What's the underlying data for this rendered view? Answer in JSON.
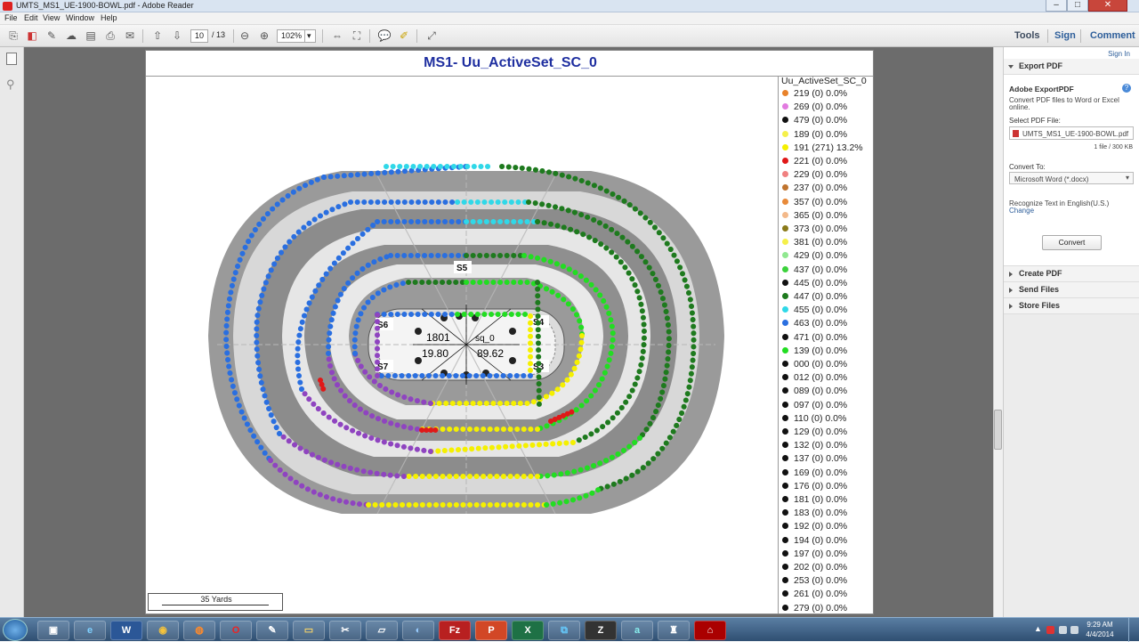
{
  "window": {
    "title": "UMTS_MS1_UE-1900-BOWL.pdf - Adobe Reader",
    "min": "–",
    "max": "□",
    "close": "✕"
  },
  "menu": [
    "File",
    "Edit",
    "View",
    "Window",
    "Help"
  ],
  "toolbar": {
    "page_current": "10",
    "page_total": "/ 13",
    "zoom": "102%",
    "tools": "Tools",
    "sign": "Sign",
    "comment": "Comment"
  },
  "document": {
    "title": "MS1- Uu_ActiveSet_SC_0",
    "scale_label": "35 Yards",
    "map_labels": {
      "s1": "S5",
      "s2": "S4",
      "s3": "S6",
      "s4": "S7",
      "s5": "S3",
      "c1": "1801",
      "c2": "19.80",
      "c3": "sq_0",
      "c4": "89.62"
    }
  },
  "legend": {
    "title": "Uu_ActiveSet_SC_0",
    "items": [
      {
        "label": "219 (0) 0.0%",
        "color": "#e8822a"
      },
      {
        "label": "269 (0) 0.0%",
        "color": "#e27be0"
      },
      {
        "label": "479 (0) 0.0%",
        "color": "#111111"
      },
      {
        "label": "189 (0) 0.0%",
        "color": "#f5f04a"
      },
      {
        "label": "191 (271) 13.2%",
        "color": "#f5f000"
      },
      {
        "label": "221 (0) 0.0%",
        "color": "#e01818"
      },
      {
        "label": "229 (0) 0.0%",
        "color": "#f08080"
      },
      {
        "label": "237 (0) 0.0%",
        "color": "#c0742e"
      },
      {
        "label": "357 (0) 0.0%",
        "color": "#e88a3a"
      },
      {
        "label": "365 (0) 0.0%",
        "color": "#f3b98a"
      },
      {
        "label": "373 (0) 0.0%",
        "color": "#8a7a1a"
      },
      {
        "label": "381 (0) 0.0%",
        "color": "#f5f04a"
      },
      {
        "label": "429 (0) 0.0%",
        "color": "#90e890"
      },
      {
        "label": "437 (0) 0.0%",
        "color": "#3cd23c"
      },
      {
        "label": "445 (0) 0.0%",
        "color": "#111111"
      },
      {
        "label": "447 (0) 0.0%",
        "color": "#1e7a1e"
      },
      {
        "label": "455 (0) 0.0%",
        "color": "#30d8e8"
      },
      {
        "label": "463 (0) 0.0%",
        "color": "#2a6fe0"
      },
      {
        "label": "471 (0) 0.0%",
        "color": "#111111"
      },
      {
        "label": "139 (0) 0.0%",
        "color": "#22dd22"
      },
      {
        "label": "000 (0) 0.0%",
        "color": "#111111"
      },
      {
        "label": "012 (0) 0.0%",
        "color": "#111111"
      },
      {
        "label": "089 (0) 0.0%",
        "color": "#111111"
      },
      {
        "label": "097 (0) 0.0%",
        "color": "#111111"
      },
      {
        "label": "110 (0) 0.0%",
        "color": "#111111"
      },
      {
        "label": "129 (0) 0.0%",
        "color": "#111111"
      },
      {
        "label": "132 (0) 0.0%",
        "color": "#111111"
      },
      {
        "label": "137 (0) 0.0%",
        "color": "#111111"
      },
      {
        "label": "169 (0) 0.0%",
        "color": "#111111"
      },
      {
        "label": "176 (0) 0.0%",
        "color": "#111111"
      },
      {
        "label": "181 (0) 0.0%",
        "color": "#111111"
      },
      {
        "label": "183 (0) 0.0%",
        "color": "#111111"
      },
      {
        "label": "192 (0) 0.0%",
        "color": "#111111"
      },
      {
        "label": "194 (0) 0.0%",
        "color": "#111111"
      },
      {
        "label": "197 (0) 0.0%",
        "color": "#111111"
      },
      {
        "label": "202 (0) 0.0%",
        "color": "#111111"
      },
      {
        "label": "253 (0) 0.0%",
        "color": "#111111"
      },
      {
        "label": "261 (0) 0.0%",
        "color": "#111111"
      },
      {
        "label": "279 (0) 0.0%",
        "color": "#111111"
      }
    ]
  },
  "right_panel": {
    "sign_in": "Sign In",
    "export_pdf": "Export PDF",
    "adobe_export": "Adobe ExportPDF",
    "desc1": "Convert PDF files to Word or Excel",
    "desc2": "online.",
    "select_label": "Select PDF File:",
    "file_name": "UMTS_MS1_UE-1900-BOWL.pdf",
    "file_info": "1 file / 300 KB",
    "convert_to": "Convert To:",
    "format": "Microsoft Word (*.docx)",
    "recognize": "Recognize Text in English(U.S.)",
    "change": "Change",
    "convert": "Convert",
    "create_pdf": "Create PDF",
    "send_files": "Send Files",
    "store_files": "Store Files"
  },
  "taskbar": {
    "time": "9:29 AM",
    "date": "4/4/2014",
    "apps": [
      "W",
      "Fz",
      "P",
      "X",
      "Z"
    ]
  }
}
